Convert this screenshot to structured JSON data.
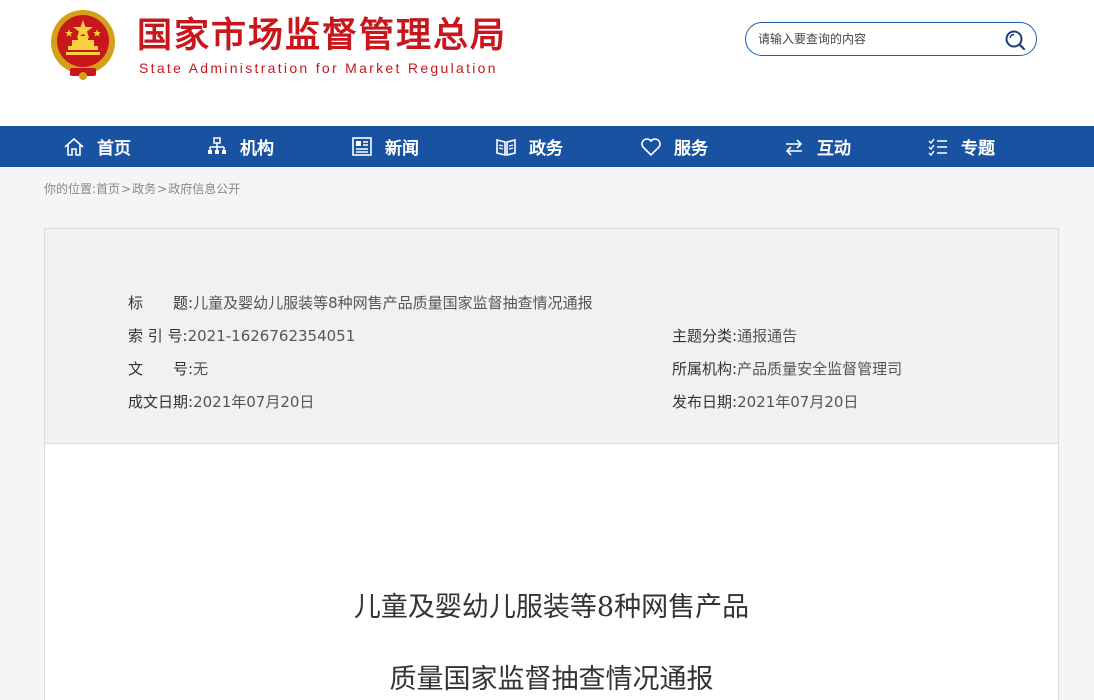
{
  "header": {
    "site_name_cn": "国家市场监督管理总局",
    "site_name_en": "State Administration for Market Regulation",
    "emblem_icon": "national-emblem-icon",
    "search": {
      "placeholder": "请输入要查询的内容",
      "icon": "search-icon"
    }
  },
  "nav": {
    "items": [
      {
        "label": "首页",
        "icon": "home-icon"
      },
      {
        "label": "机构",
        "icon": "org-chart-icon"
      },
      {
        "label": "新闻",
        "icon": "news-icon"
      },
      {
        "label": "政务",
        "icon": "book-icon"
      },
      {
        "label": "服务",
        "icon": "heart-icon"
      },
      {
        "label": "互动",
        "icon": "swap-arrows-icon"
      },
      {
        "label": "专题",
        "icon": "list-icon"
      }
    ]
  },
  "breadcrumb": {
    "prefix": "你的位置:",
    "items": [
      "首页",
      "政务",
      "政府信息公开"
    ],
    "separator": ">"
  },
  "meta": {
    "title_label": "标　　题:",
    "title_value": "儿童及婴幼儿服装等8种网售产品质量国家监督抽查情况通报",
    "index_label": "索 引 号:",
    "index_value": "2021-1626762354051",
    "doc_no_label": "文　　号:",
    "doc_no_value": "无",
    "created_label": "成文日期:",
    "created_value": "2021年07月20日",
    "category_label": "主题分类:",
    "category_value": "通报通告",
    "org_label": "所属机构:",
    "org_value": "产品质量安全监督管理司",
    "published_label": "发布日期:",
    "published_value": "2021年07月20日"
  },
  "document": {
    "title_line1": "儿童及婴幼儿服装等8种网售产品",
    "title_line2": "质量国家监督抽查情况通报"
  },
  "colors": {
    "brand_red": "#c8161d",
    "nav_blue": "#1852a0",
    "search_border": "#1a5fa8"
  }
}
